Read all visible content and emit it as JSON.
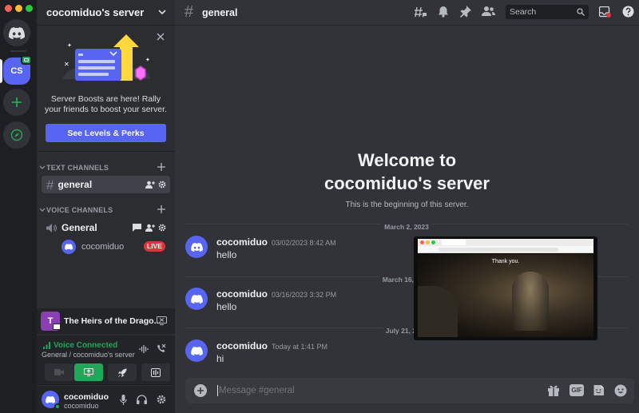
{
  "server": {
    "name": "cocomiduo's server",
    "initials": "CS"
  },
  "boost": {
    "text": "Server Boosts are here! Rally your friends to boost your server.",
    "button": "See Levels & Perks"
  },
  "categories": {
    "text": "TEXT CHANNELS",
    "voice": "VOICE CHANNELS"
  },
  "channels": {
    "text_general": "general",
    "voice_general": "General"
  },
  "voice_user": {
    "name": "cocomiduo",
    "badge": "LIVE"
  },
  "activity": {
    "title": "The Heirs of the Dragon",
    "title_display": "The Heirs of the Drago...",
    "initial": "T"
  },
  "voice": {
    "status": "Voice Connected",
    "location": "General / cocomiduo's server"
  },
  "user_panel": {
    "name": "cocomiduo",
    "tag": "cocomiduo"
  },
  "topbar": {
    "channel": "general",
    "search_placeholder": "Search"
  },
  "welcome": {
    "line1": "Welcome to",
    "line2": "cocomiduo's server",
    "sub": "This is the beginning of this server."
  },
  "dates": [
    "March 2, 2023",
    "March 16, 2023",
    "July 21, 2023"
  ],
  "messages": [
    {
      "user": "cocomiduo",
      "time": "03/02/2023 8:42 AM",
      "text": "hello"
    },
    {
      "user": "cocomiduo",
      "time": "03/16/2023 3:32 PM",
      "text": "hello"
    },
    {
      "user": "cocomiduo",
      "time": "Today at 1:41 PM",
      "text": "hi"
    }
  ],
  "composer": {
    "placeholder": "Message #general",
    "gif": "GIF"
  },
  "stream": {
    "caption": "Thank you."
  },
  "colors": {
    "accent": "#5865f2",
    "green": "#23a55a",
    "live": "#da373c"
  }
}
